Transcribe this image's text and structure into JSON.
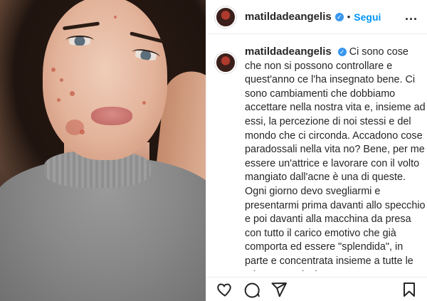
{
  "post": {
    "username": "matildadeangelis",
    "verified": true,
    "follow_label": "Segui",
    "more_label": "...",
    "caption_username": "matildadeangelis",
    "caption_text": "Ci sono cose che non si possono controllare e quest'anno ce l'ha insegnato bene. Ci sono cambiamenti che dobbiamo accettare nella nostra vita e, insieme ad essi, la percezione di noi stessi e del mondo che ci circonda. Accadono cose paradossali nella vita no? Bene, per me essere un'attrice e lavorare con il volto mangiato dall'acne è una di queste. Ogni giorno devo svegliarmi e presentarmi prima davanti allo specchio e poi davanti alla macchina da presa con tutto il carico emotivo che già comporta ed essere \"splendida\", in parte e concentrata insieme a tutte le mie paure e insicurezze"
  },
  "actions": {
    "icons": [
      "heart-icon",
      "comment-icon",
      "share-icon",
      "bookmark-icon"
    ]
  },
  "colors": {
    "accent": "#0095f6",
    "verified": "#3897f0",
    "text": "#262626"
  }
}
